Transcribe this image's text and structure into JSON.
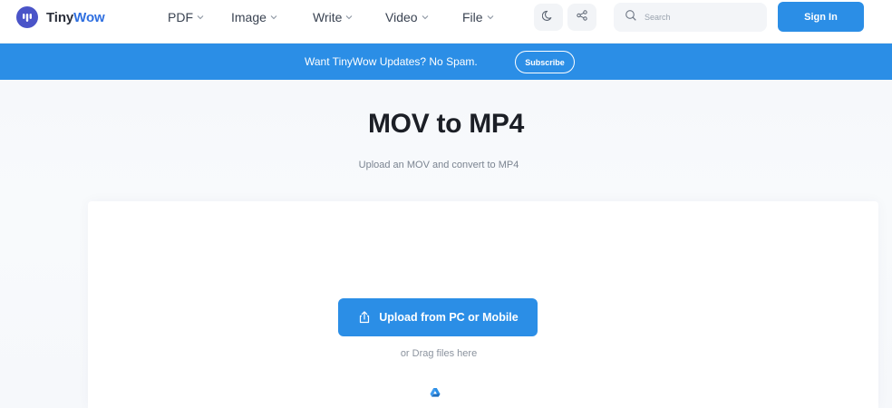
{
  "brand": {
    "name_part1": "Tiny",
    "name_part2": "Wow",
    "logo_icon": "tinywow-logo-icon",
    "accent_color": "#2b8ee6",
    "logo_color": "#4a54c8"
  },
  "nav": {
    "items": [
      {
        "label": "PDF",
        "icon": "chevron-down-icon"
      },
      {
        "label": "Image",
        "icon": "chevron-down-icon"
      },
      {
        "label": "Write",
        "icon": "chevron-down-icon"
      },
      {
        "label": "Video",
        "icon": "chevron-down-icon"
      },
      {
        "label": "File",
        "icon": "chevron-down-icon"
      }
    ]
  },
  "header": {
    "theme_toggle_icon": "moon-icon",
    "share_icon": "share-icon",
    "search_placeholder": "Search",
    "search_icon": "search-icon",
    "signin_label": "Sign In"
  },
  "banner": {
    "text": "Want TinyWow Updates? No Spam.",
    "subscribe_label": "Subscribe"
  },
  "main": {
    "title": "MOV to MP4",
    "subtitle": "Upload an MOV and convert to MP4",
    "upload_label": "Upload from PC or Mobile",
    "upload_icon": "upload-icon",
    "drag_text": "or Drag files here",
    "drive_icon": "google-drive-icon"
  }
}
